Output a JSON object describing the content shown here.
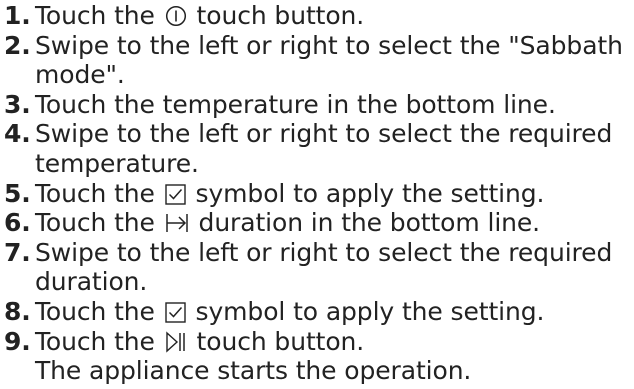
{
  "steps": [
    {
      "num": "1.",
      "before": "Touch the",
      "icon": "power-icon",
      "after": "touch button."
    },
    {
      "num": "2.",
      "text": "Swipe to the left or right to select the \"Sabbath mode\"."
    },
    {
      "num": "3.",
      "text": "Touch the temperature in the bottom line."
    },
    {
      "num": "4.",
      "text": "Swipe to the left or right to select the required temperature."
    },
    {
      "num": "5.",
      "before": "Touch the",
      "icon": "checkbox-tick-icon",
      "after": "symbol to apply the setting."
    },
    {
      "num": "6.",
      "before": "Touch the",
      "icon": "duration-icon",
      "after": "duration in the bottom line."
    },
    {
      "num": "7.",
      "text": "Swipe to the left or right to select the required duration."
    },
    {
      "num": "8.",
      "before": "Touch the",
      "icon": "checkbox-tick-icon",
      "after": "symbol to apply the setting."
    },
    {
      "num": "9.",
      "before": "Touch the",
      "icon": "start-pause-icon",
      "after": "touch button.",
      "note": "The appliance starts the operation."
    }
  ],
  "text_color": "#222222"
}
